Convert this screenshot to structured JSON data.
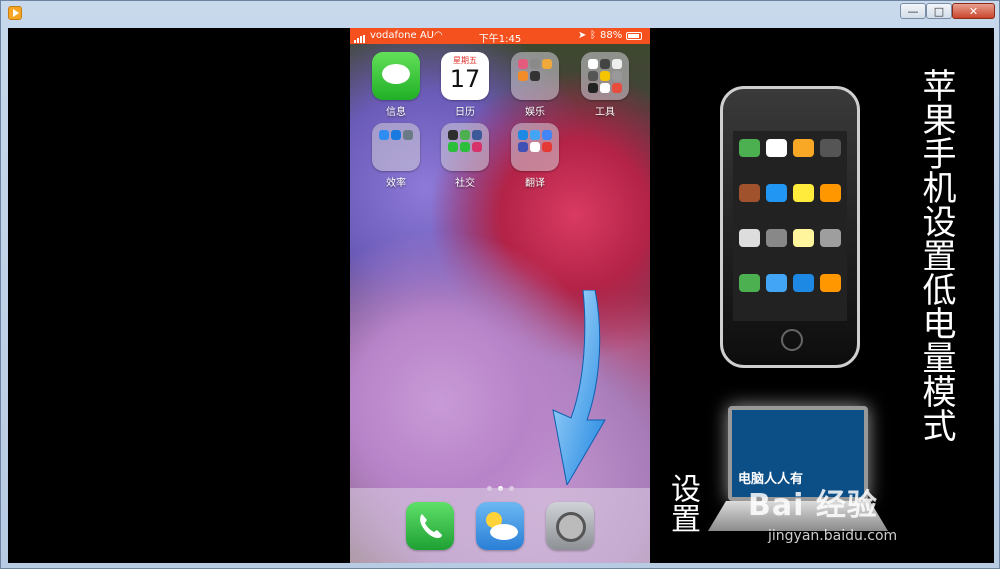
{
  "window": {
    "minimize_glyph": "—",
    "maximize_glyph": "□",
    "close_glyph": "✕"
  },
  "phone": {
    "statusbar": {
      "carrier": "vodafone AU",
      "time": "下午1:45",
      "battery": "88%"
    },
    "apps": [
      {
        "label": "信息",
        "kind": "messages"
      },
      {
        "label": "日历",
        "kind": "calendar",
        "weekday": "星期五",
        "day": "17"
      },
      {
        "label": "娱乐",
        "kind": "folder"
      },
      {
        "label": "工具",
        "kind": "folder"
      },
      {
        "label": "效率",
        "kind": "folder"
      },
      {
        "label": "社交",
        "kind": "folder"
      },
      {
        "label": "翻译",
        "kind": "folder"
      }
    ],
    "dock": [
      "phone-icon",
      "weather-icon",
      "settings-icon"
    ]
  },
  "overlay": {
    "title": "苹果手机设置低电量模式",
    "subtitle": "设置",
    "laptop_caption": "电脑人人有",
    "watermark_logo": "Bai 经验",
    "watermark_url": "jingyan.baidu.com"
  },
  "colors": {
    "statusbar": "#f4511e",
    "window_frame": "#b7cbe2",
    "video_bg": "#000000"
  }
}
